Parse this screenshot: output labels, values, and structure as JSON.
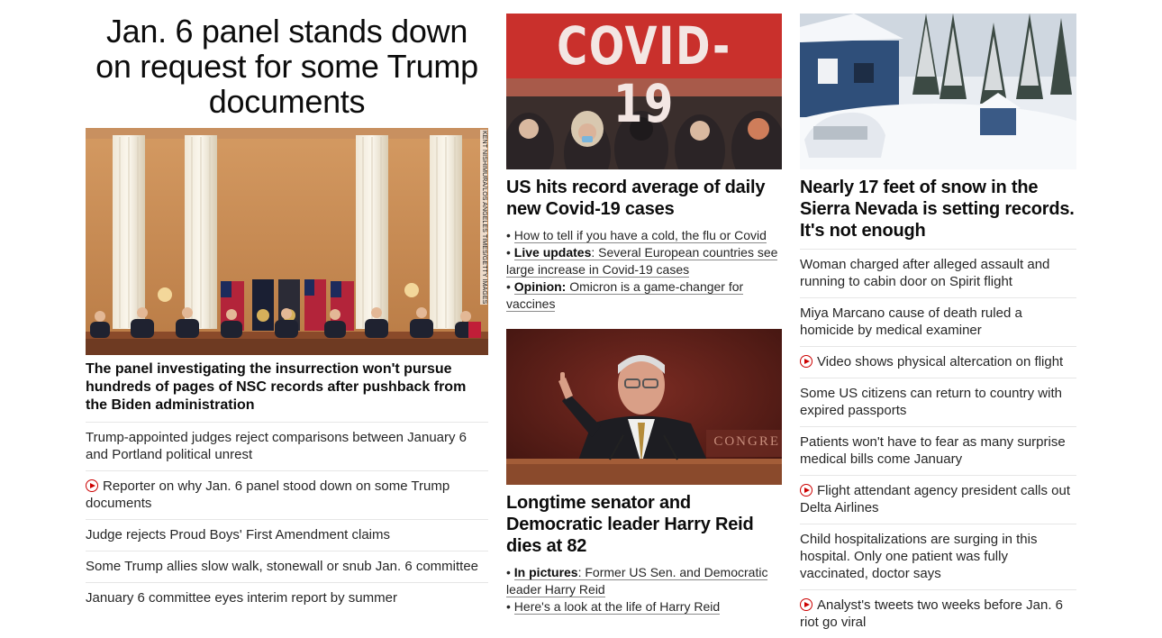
{
  "col1": {
    "hero_title": "Jan. 6 panel stands down on request for some Trump documents",
    "image_credit": "KENT NISHIMURA/LOS ANGELES TIMES/GETTY IMAGES",
    "lead": "The panel investigating the insurrection won't pursue hundreds of pages of NSC records after pushback from the Biden administration",
    "items": [
      {
        "text": "Trump-appointed judges reject comparisons between January 6 and Portland political unrest",
        "video": false
      },
      {
        "text": "Reporter on why Jan. 6 panel stood down on some Trump documents",
        "video": true
      },
      {
        "text": "Judge rejects Proud Boys' First Amendment claims",
        "video": false
      },
      {
        "text": "Some Trump allies slow walk, stonewall or snub Jan. 6 committee",
        "video": false
      },
      {
        "text": "January 6 committee eyes interim report by summer",
        "video": false
      }
    ]
  },
  "col2": {
    "covid_banner": "COVID-19",
    "covid_head": "US hits record average of daily new Covid-19 cases",
    "covid_bullets": [
      {
        "prefix": "",
        "text": "How to tell if you have a cold, the flu or Covid"
      },
      {
        "prefix": "Live updates",
        "text": ": Several European countries see large increase in Covid-19 cases"
      },
      {
        "prefix": "Opinion:",
        "text": " Omicron is a game-changer for vaccines"
      }
    ],
    "reid_podium_text": "CONGRE",
    "reid_head": "Longtime senator and Democratic leader Harry Reid dies at 82",
    "reid_bullets": [
      {
        "prefix": "In pictures",
        "text": ": Former US Sen. and Democratic leader Harry Reid"
      },
      {
        "prefix": "",
        "text": "Here's a look at the life of Harry Reid"
      }
    ]
  },
  "col3": {
    "snow_head": "Nearly 17 feet of snow in the Sierra Nevada is setting records. It's not enough",
    "items": [
      {
        "text": "Woman charged after alleged assault and running to cabin door on Spirit flight",
        "video": false
      },
      {
        "text": "Miya Marcano cause of death ruled a homicide by medical examiner",
        "video": false
      },
      {
        "text": "Video shows physical altercation on flight",
        "video": true
      },
      {
        "text": "Some US citizens can return to country with expired passports",
        "video": false
      },
      {
        "text": "Patients won't have to fear as many surprise medical bills come January",
        "video": false
      },
      {
        "text": "Flight attendant agency president calls out Delta Airlines",
        "video": true
      },
      {
        "text": "Child hospitalizations are surging in this hospital. Only one patient was fully vaccinated, doctor says",
        "video": false
      },
      {
        "text": "Analyst's tweets two weeks before Jan. 6 riot go viral",
        "video": true
      }
    ]
  },
  "colors": {
    "video_red": "#cc0000",
    "divider": "#e6e6e6",
    "text": "#0c0c0c"
  }
}
